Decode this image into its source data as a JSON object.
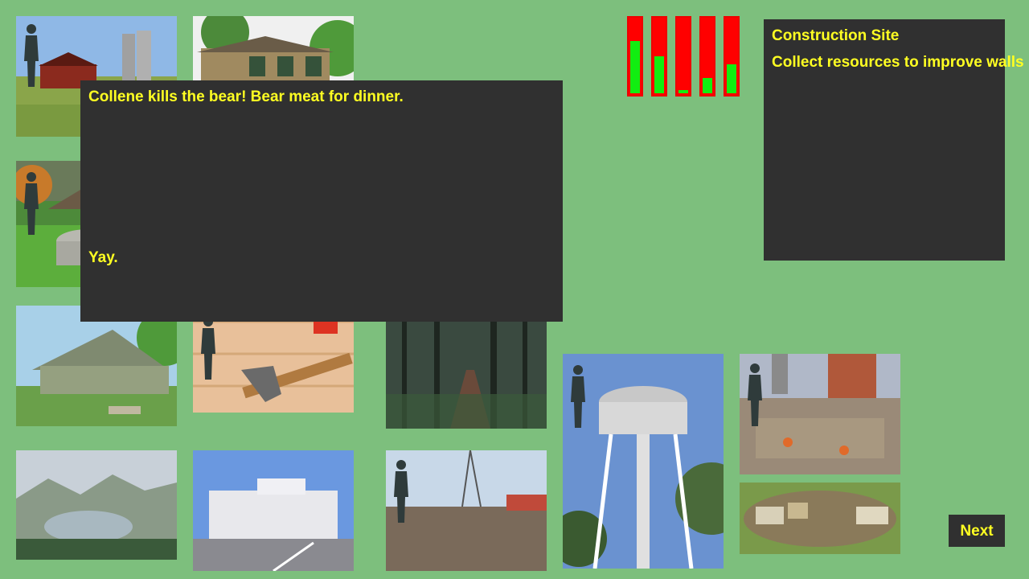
{
  "dialog": {
    "message": "Collene kills the bear! Bear meat for dinner.",
    "reply": "Yay."
  },
  "location": {
    "title": "Construction Site",
    "description": "Collect resources to improve walls"
  },
  "resource_meters": [
    {
      "level": 0.68
    },
    {
      "level": 0.48
    },
    {
      "level": 0.04
    },
    {
      "level": 0.2
    },
    {
      "level": 0.38
    }
  ],
  "next_label": "Next",
  "locations": [
    {
      "name": "farm-barn-silos",
      "has_person": true
    },
    {
      "name": "brick-building",
      "has_person": false
    },
    {
      "name": "stone-well",
      "has_person": true
    },
    {
      "name": "wooden-barracks",
      "has_person": false
    },
    {
      "name": "carpentry-tools",
      "has_person": true
    },
    {
      "name": "forest-path",
      "has_person": false
    },
    {
      "name": "water-tower",
      "has_person": true
    },
    {
      "name": "construction-site",
      "has_person": true
    },
    {
      "name": "mountain-lake",
      "has_person": false
    },
    {
      "name": "hospital",
      "has_person": false
    },
    {
      "name": "wasteland-pylons",
      "has_person": true
    },
    {
      "name": "caravan-camp",
      "has_person": false
    }
  ],
  "colors": {
    "background": "#7dbf7d",
    "panel": "#303030",
    "text": "#ffff22",
    "meter_empty": "#ff0000",
    "meter_fill": "#11ee11"
  }
}
